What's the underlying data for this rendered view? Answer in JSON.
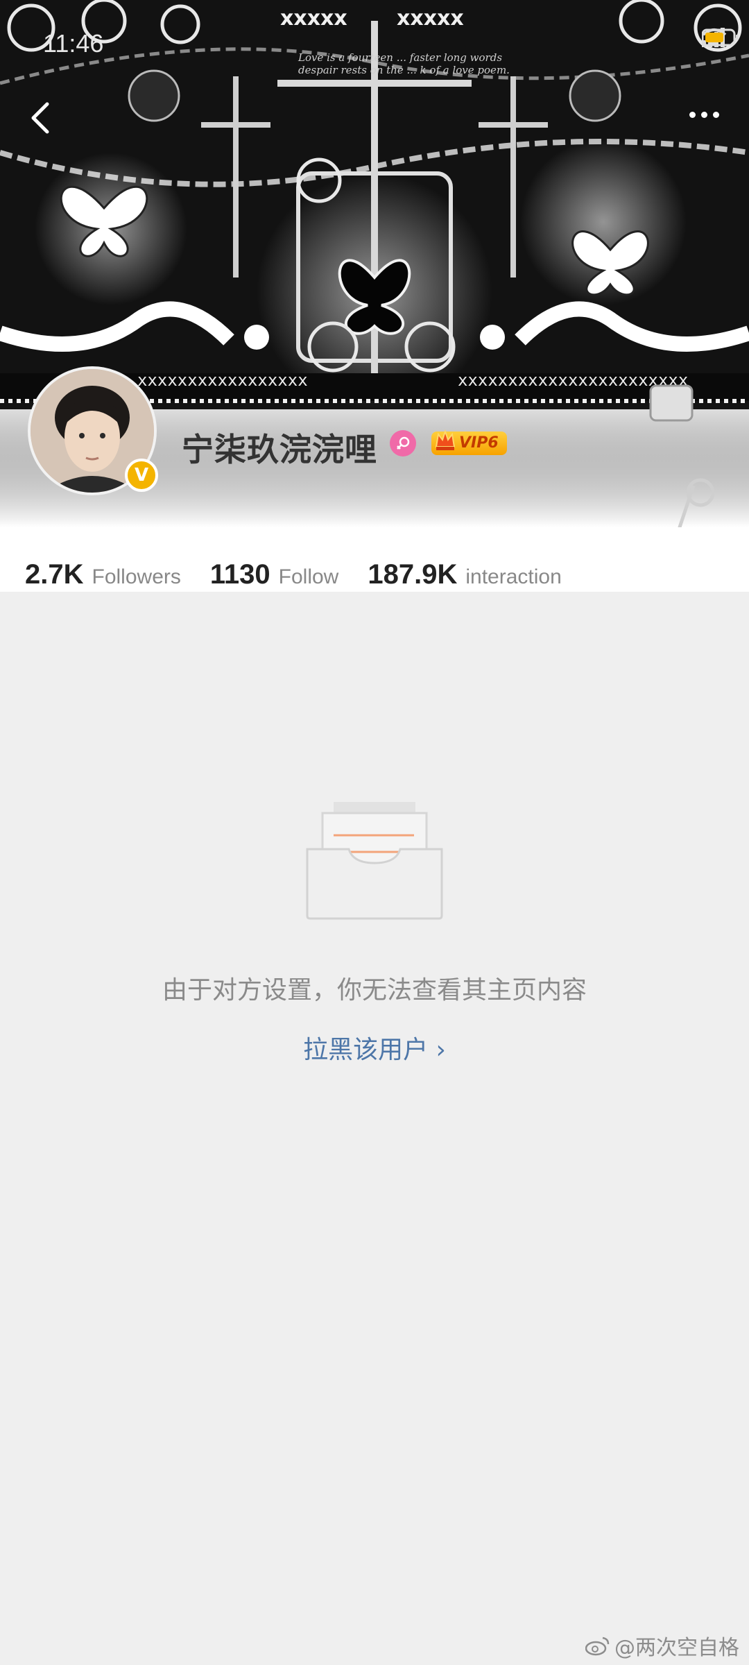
{
  "status_bar": {
    "time": "11:46"
  },
  "banner": {
    "header_labels": [
      "xxxxx",
      "xxxxx"
    ],
    "poem": [
      "Love is a fourteen ... faster long words",
      "despair rests on the ... k of a love poem."
    ],
    "strip_text_left": "xxxxxxxxxxxxxxxxx",
    "strip_text_right": "xxxxxxxxxxxxxxxxxxxxxxx"
  },
  "profile": {
    "name": "宁柒玖浣浣哩",
    "vip_label": "VIP6",
    "verify_mark": "V"
  },
  "stats": [
    {
      "value": "2.7K",
      "label": "Followers"
    },
    {
      "value": "1130",
      "label": "Follow"
    },
    {
      "value": "187.9K",
      "label": "interaction"
    }
  ],
  "empty_state": {
    "message": "由于对方设置，你无法查看其主页内容",
    "action": "拉黑该用户",
    "action_chevron": "›"
  },
  "watermark": "@两次空自格",
  "colors": {
    "page_bg": "#efefef",
    "link": "#4d76a8",
    "vip_gold": "#f7a200",
    "gender_pink": "#f06aa8"
  }
}
